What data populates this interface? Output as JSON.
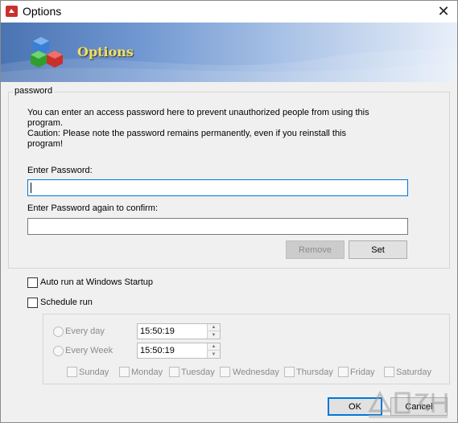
{
  "window": {
    "title": "Options",
    "close_glyph": "✕"
  },
  "banner": {
    "title": "Options",
    "logo_icon": "color-cubes-icon"
  },
  "password_group": {
    "legend": "password",
    "info_line1": "You can enter an access password here to prevent unauthorized people from using this",
    "info_line2": "program.",
    "caution_line1": "Caution: Please note the password remains permanently, even if you reinstall this",
    "caution_line2": "program!",
    "enter_label": "Enter Password:",
    "enter_value": "",
    "confirm_label": "Enter Password again to confirm:",
    "confirm_value": "",
    "remove_label": "Remove",
    "set_label": "Set"
  },
  "options": {
    "autorun_label": "Auto run at Windows Startup",
    "autorun_checked": false,
    "schedule_label": "Schedule run",
    "schedule_checked": false
  },
  "schedule": {
    "every_day_label": "Every day",
    "every_day_time": "15:50:19",
    "every_week_label": "Every Week",
    "every_week_time": "15:50:19",
    "days": [
      "Sunday",
      "Monday",
      "Tuesday",
      "Wednesday",
      "Thursday",
      "Friday",
      "Saturday"
    ]
  },
  "footer": {
    "ok_label": "OK",
    "cancel_label": "Cancel"
  },
  "colors": {
    "accent": "#0078d7",
    "banner_title": "#f2e060",
    "banner_blue": "#4a73b2"
  }
}
